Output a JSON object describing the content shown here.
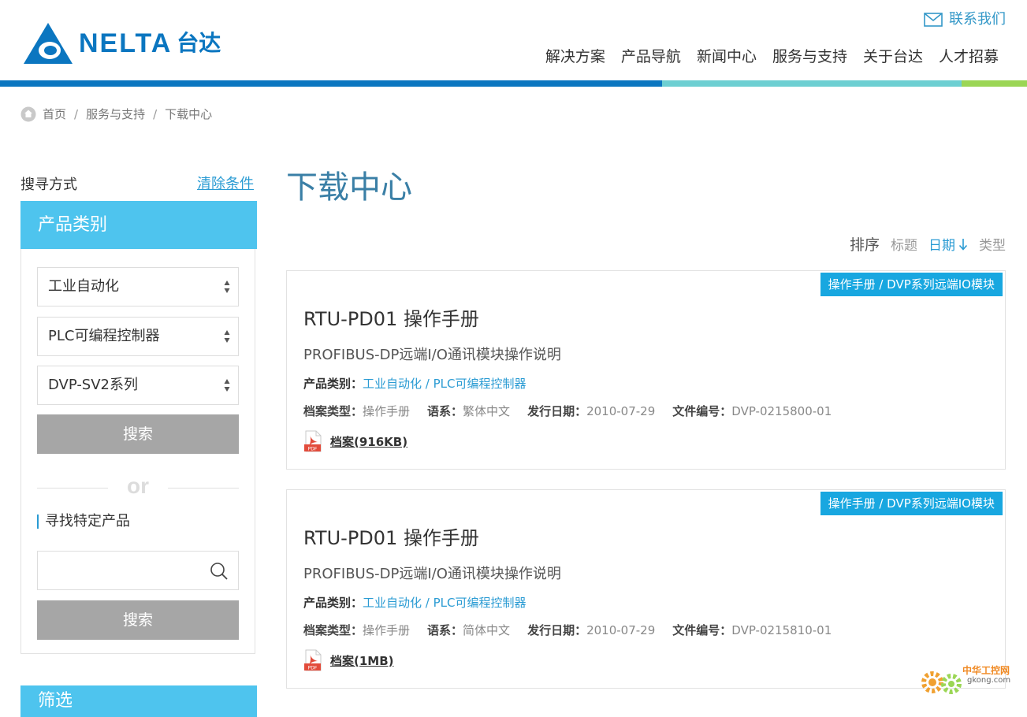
{
  "header": {
    "logo_text": "NELTA",
    "logo_cn": "台达",
    "contact_label": "联系我们",
    "nav": [
      "解决方案",
      "产品导航",
      "新闻中心",
      "服务与支持",
      "关于台达",
      "人才招募"
    ]
  },
  "breadcrumb": {
    "home": "首页",
    "level1": "服务与支持",
    "level2": "下载中心",
    "separator": "/"
  },
  "sidebar": {
    "search_method": "搜寻方式",
    "clear_label": "清除条件",
    "category_title": "产品类别",
    "selects": [
      "工业自动化",
      "PLC可编程控制器",
      "DVP-SV2系列"
    ],
    "search_button": "搜索",
    "or_text": "or",
    "find_label": "寻找特定产品",
    "find_placeholder": "",
    "search_button_2": "搜索",
    "filter_title": "筛选"
  },
  "main": {
    "title": "下载中心",
    "sort": {
      "label": "排序",
      "options": [
        "标题",
        "日期",
        "类型"
      ],
      "active": "日期"
    },
    "docs": [
      {
        "tag": "操作手册 / DVP系列远端IO模块",
        "title": "RTU-PD01 操作手册",
        "subtitle": "PROFIBUS-DP远端I/O通讯模块操作说明",
        "category_label": "产品类别：",
        "category_value": "工业自动化 / PLC可编程控制器",
        "type_label": "档案类型：",
        "type_value": "操作手册",
        "lang_label": "语系：",
        "lang_value": "繁体中文",
        "date_label": "发行日期：",
        "date_value": "2010-07-29",
        "number_label": "文件编号：",
        "number_value": "DVP-0215800-01",
        "file_link": "档案(916KB)"
      },
      {
        "tag": "操作手册 / DVP系列远端IO模块",
        "title": "RTU-PD01 操作手册",
        "subtitle": "PROFIBUS-DP远端I/O通讯模块操作说明",
        "category_label": "产品类别：",
        "category_value": "工业自动化 / PLC可编程控制器",
        "type_label": "档案类型：",
        "type_value": "操作手册",
        "lang_label": "语系：",
        "lang_value": "简体中文",
        "date_label": "发行日期：",
        "date_value": "2010-07-29",
        "number_label": "文件编号：",
        "number_value": "DVP-0215810-01",
        "file_link": "档案(1MB)"
      }
    ]
  },
  "watermark": {
    "text": "中华工控网",
    "domain": "gkong.com"
  },
  "colors": {
    "brand_blue": "#0b76c0",
    "accent": "#2a9bd3",
    "panel": "#4ec4ee",
    "tag": "#18a7e0",
    "button_gray": "#a6a6a6",
    "bar_teal": "#6dcfd2",
    "bar_green": "#9bd655"
  }
}
